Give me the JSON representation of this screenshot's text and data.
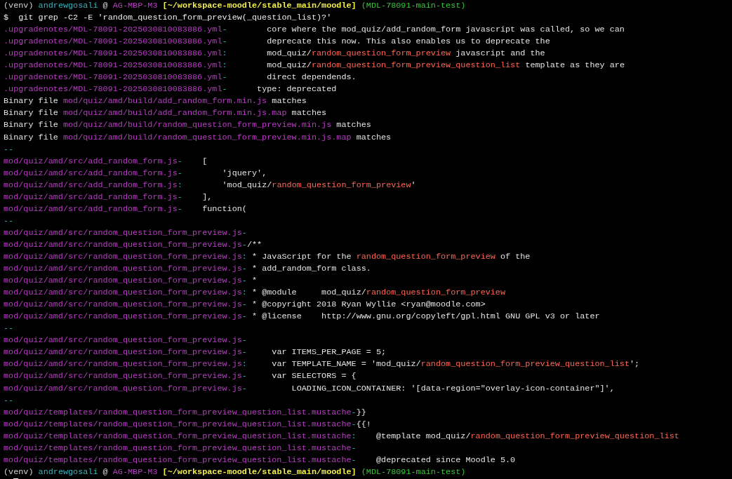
{
  "terminal": {
    "lines": [
      {
        "kind": "prompt",
        "segments": [
          {
            "kind": "plain",
            "text": "(venv) "
          },
          {
            "kind": "user",
            "text": "andrewgosali"
          },
          {
            "kind": "plain",
            "text": " @ "
          },
          {
            "kind": "host",
            "text": "AG-MBP-M3"
          },
          {
            "kind": "cwd",
            "text": "[~/workspace-moodle/stable_main/moodle]"
          },
          {
            "kind": "branch",
            "text": "(MDL-78091-main-test)"
          }
        ]
      },
      {
        "kind": "command",
        "segments": [
          {
            "kind": "plain",
            "text": "$  git grep -C2 -E 'random_question_form_preview(_question_list)?'"
          }
        ]
      },
      {
        "kind": "output",
        "segments": [
          {
            "kind": "path",
            "text": ".upgradenotes/MDL-78091-2025030810083886.yml"
          },
          {
            "kind": "sep",
            "text": "-"
          },
          {
            "kind": "plain",
            "text": "        core where the mod_quiz/add_random_form javascript was called, so we can"
          }
        ]
      },
      {
        "kind": "output",
        "segments": [
          {
            "kind": "path",
            "text": ".upgradenotes/MDL-78091-2025030810083886.yml"
          },
          {
            "kind": "sep",
            "text": "-"
          },
          {
            "kind": "plain",
            "text": "        deprecate this now. This also enables us to deprecate the"
          }
        ]
      },
      {
        "kind": "output",
        "segments": [
          {
            "kind": "path",
            "text": ".upgradenotes/MDL-78091-2025030810083886.yml"
          },
          {
            "kind": "sep",
            "text": ":"
          },
          {
            "kind": "plain",
            "text": "        mod_quiz/"
          },
          {
            "kind": "hit",
            "text": "random_question_form_preview"
          },
          {
            "kind": "plain",
            "text": " javascript and the"
          }
        ]
      },
      {
        "kind": "output",
        "segments": [
          {
            "kind": "path",
            "text": ".upgradenotes/MDL-78091-2025030810083886.yml"
          },
          {
            "kind": "sep",
            "text": ":"
          },
          {
            "kind": "plain",
            "text": "        mod_quiz/"
          },
          {
            "kind": "hit",
            "text": "random_question_form_preview_question_list"
          },
          {
            "kind": "plain",
            "text": " template as they are"
          }
        ]
      },
      {
        "kind": "output",
        "segments": [
          {
            "kind": "path",
            "text": ".upgradenotes/MDL-78091-2025030810083886.yml"
          },
          {
            "kind": "sep",
            "text": "-"
          },
          {
            "kind": "plain",
            "text": "        direct dependends."
          }
        ]
      },
      {
        "kind": "output",
        "segments": [
          {
            "kind": "path",
            "text": ".upgradenotes/MDL-78091-2025030810083886.yml"
          },
          {
            "kind": "sep",
            "text": "-"
          },
          {
            "kind": "plain",
            "text": "      type: deprecated"
          }
        ]
      },
      {
        "kind": "output",
        "segments": [
          {
            "kind": "plain",
            "text": "Binary file "
          },
          {
            "kind": "path",
            "text": "mod/quiz/amd/build/add_random_form.min.js"
          },
          {
            "kind": "plain",
            "text": " matches"
          }
        ]
      },
      {
        "kind": "output",
        "segments": [
          {
            "kind": "plain",
            "text": "Binary file "
          },
          {
            "kind": "path",
            "text": "mod/quiz/amd/build/add_random_form.min.js.map"
          },
          {
            "kind": "plain",
            "text": " matches"
          }
        ]
      },
      {
        "kind": "output",
        "segments": [
          {
            "kind": "plain",
            "text": "Binary file "
          },
          {
            "kind": "path",
            "text": "mod/quiz/amd/build/random_question_form_preview.min.js"
          },
          {
            "kind": "plain",
            "text": " matches"
          }
        ]
      },
      {
        "kind": "output",
        "segments": [
          {
            "kind": "plain",
            "text": "Binary file "
          },
          {
            "kind": "path",
            "text": "mod/quiz/amd/build/random_question_form_preview.min.js.map"
          },
          {
            "kind": "plain",
            "text": " matches"
          }
        ]
      },
      {
        "kind": "separator",
        "segments": [
          {
            "kind": "sep",
            "text": "--"
          }
        ]
      },
      {
        "kind": "output",
        "segments": [
          {
            "kind": "path",
            "text": "mod/quiz/amd/src/add_random_form.js"
          },
          {
            "kind": "sep",
            "text": "-"
          },
          {
            "kind": "plain",
            "text": "    ["
          }
        ]
      },
      {
        "kind": "output",
        "segments": [
          {
            "kind": "path",
            "text": "mod/quiz/amd/src/add_random_form.js"
          },
          {
            "kind": "sep",
            "text": "-"
          },
          {
            "kind": "plain",
            "text": "        'jquery',"
          }
        ]
      },
      {
        "kind": "output",
        "segments": [
          {
            "kind": "path",
            "text": "mod/quiz/amd/src/add_random_form.js"
          },
          {
            "kind": "sep",
            "text": ":"
          },
          {
            "kind": "plain",
            "text": "        'mod_quiz/"
          },
          {
            "kind": "hit",
            "text": "random_question_form_preview"
          },
          {
            "kind": "plain",
            "text": "'"
          }
        ]
      },
      {
        "kind": "output",
        "segments": [
          {
            "kind": "path",
            "text": "mod/quiz/amd/src/add_random_form.js"
          },
          {
            "kind": "sep",
            "text": "-"
          },
          {
            "kind": "plain",
            "text": "    ],"
          }
        ]
      },
      {
        "kind": "output",
        "segments": [
          {
            "kind": "path",
            "text": "mod/quiz/amd/src/add_random_form.js"
          },
          {
            "kind": "sep",
            "text": "-"
          },
          {
            "kind": "plain",
            "text": "    function("
          }
        ]
      },
      {
        "kind": "separator",
        "segments": [
          {
            "kind": "sep",
            "text": "--"
          }
        ]
      },
      {
        "kind": "output",
        "segments": [
          {
            "kind": "path",
            "text": "mod/quiz/amd/src/random_question_form_preview.js"
          },
          {
            "kind": "sep",
            "text": "-"
          }
        ]
      },
      {
        "kind": "output",
        "segments": [
          {
            "kind": "path",
            "text": "mod/quiz/amd/src/random_question_form_preview.js"
          },
          {
            "kind": "sep",
            "text": "-"
          },
          {
            "kind": "plain",
            "text": "/**"
          }
        ]
      },
      {
        "kind": "output",
        "segments": [
          {
            "kind": "path",
            "text": "mod/quiz/amd/src/random_question_form_preview.js"
          },
          {
            "kind": "sep",
            "text": ":"
          },
          {
            "kind": "plain",
            "text": " * JavaScript for the "
          },
          {
            "kind": "hit",
            "text": "random_question_form_preview"
          },
          {
            "kind": "plain",
            "text": " of the"
          }
        ]
      },
      {
        "kind": "output",
        "segments": [
          {
            "kind": "path",
            "text": "mod/quiz/amd/src/random_question_form_preview.js"
          },
          {
            "kind": "sep",
            "text": "-"
          },
          {
            "kind": "plain",
            "text": " * add_random_form class."
          }
        ]
      },
      {
        "kind": "output",
        "segments": [
          {
            "kind": "path",
            "text": "mod/quiz/amd/src/random_question_form_preview.js"
          },
          {
            "kind": "sep",
            "text": "-"
          },
          {
            "kind": "plain",
            "text": " *"
          }
        ]
      },
      {
        "kind": "output",
        "segments": [
          {
            "kind": "path",
            "text": "mod/quiz/amd/src/random_question_form_preview.js"
          },
          {
            "kind": "sep",
            "text": ":"
          },
          {
            "kind": "plain",
            "text": " * @module     mod_quiz/"
          },
          {
            "kind": "hit",
            "text": "random_question_form_preview"
          }
        ]
      },
      {
        "kind": "output",
        "segments": [
          {
            "kind": "path",
            "text": "mod/quiz/amd/src/random_question_form_preview.js"
          },
          {
            "kind": "sep",
            "text": "-"
          },
          {
            "kind": "plain",
            "text": " * @copyright 2018 Ryan Wyllie <ryan@moodle.com>"
          }
        ]
      },
      {
        "kind": "output",
        "segments": [
          {
            "kind": "path",
            "text": "mod/quiz/amd/src/random_question_form_preview.js"
          },
          {
            "kind": "sep",
            "text": "-"
          },
          {
            "kind": "plain",
            "text": " * @license    http://www.gnu.org/copyleft/gpl.html GNU GPL v3 or later"
          }
        ]
      },
      {
        "kind": "separator",
        "segments": [
          {
            "kind": "sep",
            "text": "--"
          }
        ]
      },
      {
        "kind": "output",
        "segments": [
          {
            "kind": "path",
            "text": "mod/quiz/amd/src/random_question_form_preview.js"
          },
          {
            "kind": "sep",
            "text": "-"
          }
        ]
      },
      {
        "kind": "output",
        "segments": [
          {
            "kind": "path",
            "text": "mod/quiz/amd/src/random_question_form_preview.js"
          },
          {
            "kind": "sep",
            "text": "-"
          },
          {
            "kind": "plain",
            "text": "     var ITEMS_PER_PAGE = 5;"
          }
        ]
      },
      {
        "kind": "output",
        "segments": [
          {
            "kind": "path",
            "text": "mod/quiz/amd/src/random_question_form_preview.js"
          },
          {
            "kind": "sep",
            "text": ":"
          },
          {
            "kind": "plain",
            "text": "     var TEMPLATE_NAME = 'mod_quiz/"
          },
          {
            "kind": "hit",
            "text": "random_question_form_preview_question_list"
          },
          {
            "kind": "plain",
            "text": "';"
          }
        ]
      },
      {
        "kind": "output",
        "segments": [
          {
            "kind": "path",
            "text": "mod/quiz/amd/src/random_question_form_preview.js"
          },
          {
            "kind": "sep",
            "text": "-"
          },
          {
            "kind": "plain",
            "text": "     var SELECTORS = {"
          }
        ]
      },
      {
        "kind": "output",
        "segments": [
          {
            "kind": "path",
            "text": "mod/quiz/amd/src/random_question_form_preview.js"
          },
          {
            "kind": "sep",
            "text": "-"
          },
          {
            "kind": "plain",
            "text": "         LOADING_ICON_CONTAINER: '[data-region=\"overlay-icon-container\"]',"
          }
        ]
      },
      {
        "kind": "separator",
        "segments": [
          {
            "kind": "sep",
            "text": "--"
          }
        ]
      },
      {
        "kind": "output",
        "segments": [
          {
            "kind": "path",
            "text": "mod/quiz/templates/random_question_form_preview_question_list.mustache"
          },
          {
            "kind": "sep",
            "text": "-"
          },
          {
            "kind": "plain",
            "text": "}}"
          }
        ]
      },
      {
        "kind": "output",
        "segments": [
          {
            "kind": "path",
            "text": "mod/quiz/templates/random_question_form_preview_question_list.mustache"
          },
          {
            "kind": "sep",
            "text": "-"
          },
          {
            "kind": "plain",
            "text": "{{!"
          }
        ]
      },
      {
        "kind": "output",
        "segments": [
          {
            "kind": "path",
            "text": "mod/quiz/templates/random_question_form_preview_question_list.mustache"
          },
          {
            "kind": "sep",
            "text": ":"
          },
          {
            "kind": "plain",
            "text": "    @template mod_quiz/"
          },
          {
            "kind": "hit",
            "text": "random_question_form_preview_question_list"
          }
        ]
      },
      {
        "kind": "output",
        "segments": [
          {
            "kind": "path",
            "text": "mod/quiz/templates/random_question_form_preview_question_list.mustache"
          },
          {
            "kind": "sep",
            "text": "-"
          }
        ]
      },
      {
        "kind": "output",
        "segments": [
          {
            "kind": "path",
            "text": "mod/quiz/templates/random_question_form_preview_question_list.mustache"
          },
          {
            "kind": "sep",
            "text": "-"
          },
          {
            "kind": "plain",
            "text": "    @deprecated since Moodle 5.0"
          }
        ]
      },
      {
        "kind": "prompt",
        "segments": [
          {
            "kind": "plain",
            "text": "(venv) "
          },
          {
            "kind": "user",
            "text": "andrewgosali"
          },
          {
            "kind": "plain",
            "text": " @ "
          },
          {
            "kind": "host",
            "text": "AG-MBP-M3"
          },
          {
            "kind": "cwd",
            "text": "[~/workspace-moodle/stable_main/moodle]"
          },
          {
            "kind": "branch",
            "text": "(MDL-78091-main-test)"
          }
        ]
      }
    ]
  }
}
